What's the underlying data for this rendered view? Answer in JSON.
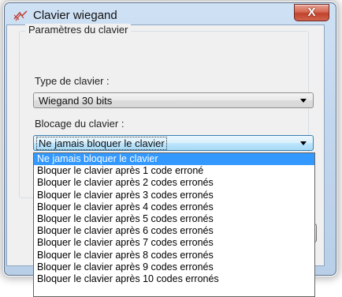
{
  "window": {
    "title": "Clavier wiegand",
    "close_glyph": "X",
    "icon": "keypad-icon"
  },
  "group": {
    "legend": "Paramètres du clavier"
  },
  "keypad_type": {
    "label": "Type de clavier :",
    "value": "Wiegand 30 bits"
  },
  "keypad_lock": {
    "label": "Blocage du clavier :",
    "value": "Ne jamais bloquer le clavier",
    "options": [
      "Ne jamais bloquer le clavier",
      "Bloquer le clavier après 1 code erroné",
      "Bloquer le clavier après 2 codes erronés",
      "Bloquer le clavier après 3 codes erronés",
      "Bloquer le clavier après 4 codes erronés",
      "Bloquer le clavier après 5 codes erronés",
      "Bloquer le clavier après 6 codes erronés",
      "Bloquer le clavier après 7 codes erronés",
      "Bloquer le clavier après 8 codes erronés",
      "Bloquer le clavier après 9 codes erronés",
      "Bloquer le clavier après 10 codes erronés"
    ],
    "selected_index": 0
  },
  "colors": {
    "selection": "#3399ff",
    "close_button": "#c7432b",
    "window_frame": "#c3d7ee"
  }
}
